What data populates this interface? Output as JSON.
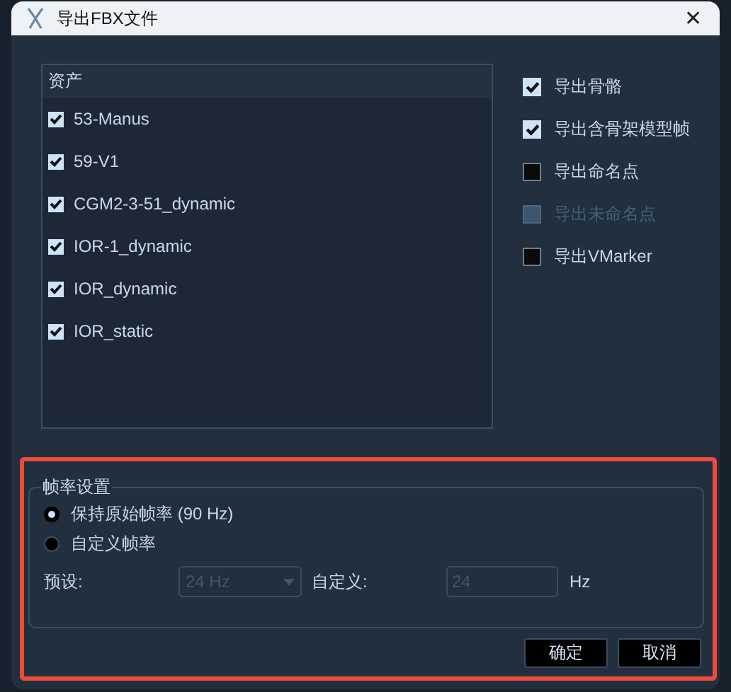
{
  "window": {
    "title": "导出FBX文件",
    "close": "✕"
  },
  "assets": {
    "header": "资产",
    "items": [
      {
        "label": "53-Manus",
        "checked": true
      },
      {
        "label": "59-V1",
        "checked": true
      },
      {
        "label": "CGM2-3-51_dynamic",
        "checked": true
      },
      {
        "label": "IOR-1_dynamic",
        "checked": true
      },
      {
        "label": "IOR_dynamic",
        "checked": true
      },
      {
        "label": "IOR_static",
        "checked": true
      }
    ]
  },
  "options": [
    {
      "label": "导出骨骼",
      "checked": true,
      "disabled": false
    },
    {
      "label": "导出含骨架模型帧",
      "checked": true,
      "disabled": false
    },
    {
      "label": "导出命名点",
      "checked": false,
      "disabled": false
    },
    {
      "label": "导出未命名点",
      "checked": false,
      "disabled": true
    },
    {
      "label": "导出VMarker",
      "checked": false,
      "disabled": false
    }
  ],
  "frame_rate": {
    "legend": "帧率设置",
    "radios": [
      {
        "label": "保持原始帧率 (90 Hz)",
        "selected": true
      },
      {
        "label": "自定义帧率",
        "selected": false
      }
    ],
    "preset_label": "预设:",
    "preset_value": "24 Hz",
    "custom_label": "自定义:",
    "custom_value": "24",
    "unit": "Hz",
    "disabled": true
  },
  "buttons": [
    "确定",
    "取消"
  ],
  "highlight": true
}
